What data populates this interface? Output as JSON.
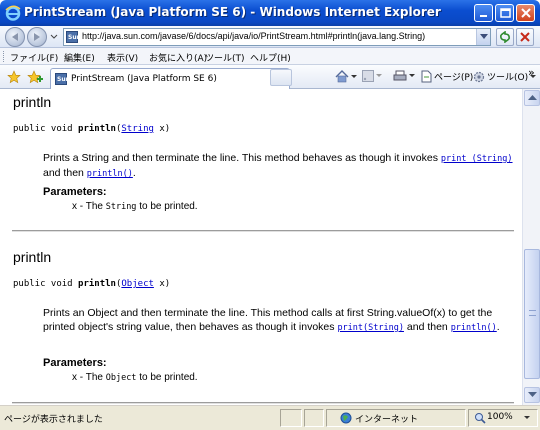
{
  "window": {
    "title": "PrintStream (Java Platform SE 6) - Windows Internet Explorer"
  },
  "address_bar": {
    "url": "http://java.sun.com/javase/6/docs/api/java/io/PrintStream.html#println(java.lang.String)"
  },
  "menu": {
    "items": [
      "ファイル(F)",
      "編集(E)",
      "表示(V)",
      "お気に入り(A)",
      "ツール(T)",
      "ヘルプ(H)"
    ]
  },
  "tab": {
    "label": "PrintStream (Java Platform SE 6)"
  },
  "commands": {
    "page": "ページ(P)",
    "tools": "ツール(O)",
    "more": "»"
  },
  "sections": [
    {
      "heading": "println",
      "sig_prefix": "public void ",
      "sig_name": "println",
      "sig_open": "(",
      "sig_type": "String",
      "sig_close": " x)",
      "desc_1": "Prints a String and then terminate the line. This method behaves as though it invokes ",
      "desc_link1": "print (String)",
      "desc_2": " and then ",
      "desc_link2": "println()",
      "desc_3": ".",
      "params_label": "Parameters:",
      "param_name": "x",
      "param_dash": " - The ",
      "param_type": "String",
      "param_rest": " to be printed."
    },
    {
      "heading": "println",
      "sig_prefix": "public void ",
      "sig_name": "println",
      "sig_open": "(",
      "sig_type": "Object",
      "sig_close": " x)",
      "desc_1": "Prints an Object and then terminate the line. This method calls at first String.valueOf(x) to get the printed object's string value, then behaves as though it invokes ",
      "desc_link1": "print(String)",
      "desc_2": " and then ",
      "desc_link2": "println()",
      "desc_3": ".",
      "params_label": "Parameters:",
      "param_name": "x",
      "param_dash": " - The ",
      "param_type": "Object",
      "param_rest": " to be printed."
    }
  ],
  "status": {
    "message": "ページが表示されました",
    "zone": "インターネット",
    "zoom": "100%"
  }
}
